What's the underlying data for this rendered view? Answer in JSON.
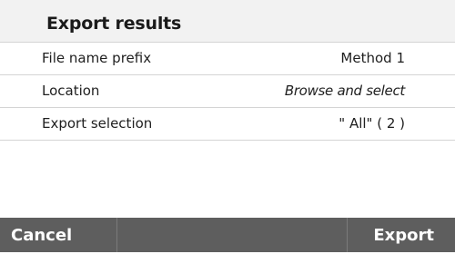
{
  "dialog": {
    "title": "Export results",
    "rows": [
      {
        "label": "File name prefix",
        "value": "Method 1"
      },
      {
        "label": "Location",
        "value": "Browse and select"
      },
      {
        "label": "Export selection",
        "value": "\" All\" ( 2 )"
      }
    ]
  },
  "footer": {
    "cancel_label": "Cancel",
    "export_label": "Export"
  },
  "colors": {
    "header_bg": "#f2f2f2",
    "footer_bg": "#5e5e5e",
    "divider": "#d4d4d4"
  }
}
